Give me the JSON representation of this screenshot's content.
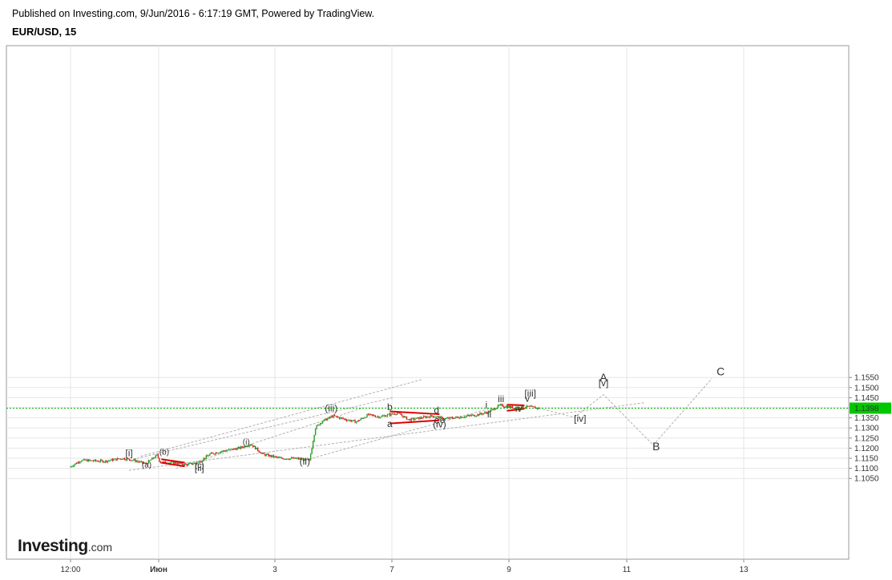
{
  "header": {
    "published": "Published on Investing.com, 9/Jun/2016 - 6:17:19 GMT, Powered by TradingView.",
    "symbol": "EUR/USD, 15"
  },
  "logo": {
    "brand": "Investing",
    "suffix": ".com"
  },
  "colors": {
    "up": "#2ca02c",
    "down": "#d62728",
    "guide": "#b0b0b0",
    "triangle": "#e00000",
    "price_line": "#00b000",
    "price_badge": "#00c800",
    "grid": "#e6e6e6"
  },
  "chart_data": {
    "type": "candlestick",
    "title": "EUR/USD, 15",
    "current_price": "1.1398",
    "ylim": [
      1.105,
      1.155
    ],
    "y_ticks": [
      "1.1550",
      "1.1500",
      "1.1450",
      "1.1400",
      "1.1350",
      "1.1300",
      "1.1250",
      "1.1200",
      "1.1150",
      "1.1100",
      "1.1050"
    ],
    "x_ticks": [
      "12:00",
      "Июн",
      "3",
      "7",
      "9",
      "11",
      "13"
    ],
    "grid": true,
    "price_path": [
      [
        0.0,
        1.1105
      ],
      [
        0.2,
        1.114
      ],
      [
        0.6,
        1.1135
      ],
      [
        0.9,
        1.115
      ],
      [
        1.1,
        1.114
      ],
      [
        1.3,
        1.1122
      ],
      [
        1.5,
        1.1165
      ],
      [
        1.55,
        1.113
      ],
      [
        1.8,
        1.1128
      ],
      [
        2.0,
        1.1118
      ],
      [
        2.2,
        1.1128
      ],
      [
        2.4,
        1.117
      ],
      [
        2.6,
        1.1185
      ],
      [
        2.9,
        1.12
      ],
      [
        3.1,
        1.122
      ],
      [
        3.3,
        1.117
      ],
      [
        3.6,
        1.115
      ],
      [
        3.9,
        1.1148
      ],
      [
        4.1,
        1.1138
      ],
      [
        4.2,
        1.13
      ],
      [
        4.3,
        1.133
      ],
      [
        4.5,
        1.136
      ],
      [
        4.7,
        1.1343
      ],
      [
        4.9,
        1.133
      ],
      [
        5.1,
        1.1365
      ],
      [
        5.3,
        1.1355
      ],
      [
        5.6,
        1.1375
      ],
      [
        5.8,
        1.134
      ],
      [
        6.0,
        1.135
      ],
      [
        6.2,
        1.136
      ],
      [
        6.4,
        1.1345
      ],
      [
        6.7,
        1.1355
      ],
      [
        6.95,
        1.1365
      ],
      [
        7.15,
        1.1378
      ],
      [
        7.35,
        1.1412
      ],
      [
        7.6,
        1.14
      ],
      [
        7.85,
        1.1405
      ],
      [
        8.0,
        1.1398
      ]
    ],
    "wave_labels": [
      {
        "text": "[i]",
        "x": 1.0,
        "y": 1.1159
      },
      {
        "text": "(b)",
        "x": 1.6,
        "y": 1.1168
      },
      {
        "text": "(a)",
        "x": 1.3,
        "y": 1.1105
      },
      {
        "text": "(c)",
        "x": 2.2,
        "y": 1.1102
      },
      {
        "text": "[ii]",
        "x": 2.2,
        "y": 1.1087
      },
      {
        "text": "(i)",
        "x": 3.0,
        "y": 1.1218
      },
      {
        "text": "(ii)",
        "x": 4.0,
        "y": 1.1118
      },
      {
        "text": "(iii)",
        "x": 4.45,
        "y": 1.1382
      },
      {
        "text": "b",
        "x": 5.45,
        "y": 1.1388
      },
      {
        "text": "a",
        "x": 5.45,
        "y": 1.1305
      },
      {
        "text": "d",
        "x": 6.25,
        "y": 1.1373
      },
      {
        "text": "c",
        "x": 6.25,
        "y": 1.1323
      },
      {
        "text": "e",
        "x": 6.35,
        "y": 1.1325
      },
      {
        "text": "(iv)",
        "x": 6.3,
        "y": 1.1302
      },
      {
        "text": "i",
        "x": 7.1,
        "y": 1.1398
      },
      {
        "text": "ii",
        "x": 7.15,
        "y": 1.1352
      },
      {
        "text": "iii",
        "x": 7.35,
        "y": 1.1428
      },
      {
        "text": "iv",
        "x": 7.65,
        "y": 1.138
      },
      {
        "text": "v",
        "x": 7.8,
        "y": 1.143
      },
      {
        "text": "[iii]",
        "x": 7.85,
        "y": 1.1455
      },
      {
        "text": "[iv]",
        "x": 8.7,
        "y": 1.133
      },
      {
        "text": "[v]",
        "x": 9.1,
        "y": 1.1507
      },
      {
        "text": "A",
        "x": 9.1,
        "y": 1.153
      },
      {
        "text": "B",
        "x": 10.0,
        "y": 1.119
      },
      {
        "text": "C",
        "x": 11.1,
        "y": 1.156
      }
    ],
    "projection": [
      [
        8.0,
        1.1398
      ],
      [
        8.6,
        1.1352
      ],
      [
        9.1,
        1.1465
      ],
      [
        9.95,
        1.1215
      ],
      [
        10.95,
        1.1545
      ]
    ],
    "channels": [
      [
        [
          1.0,
          1.114
        ],
        [
          5.5,
          1.145
        ]
      ],
      [
        [
          1.0,
          1.109
        ],
        [
          9.8,
          1.1425
        ]
      ],
      [
        [
          1.8,
          1.11
        ],
        [
          5.0,
          1.14
        ]
      ],
      [
        [
          4.0,
          1.114
        ],
        [
          7.2,
          1.14
        ]
      ],
      [
        [
          1.2,
          1.116
        ],
        [
          6.0,
          1.154
        ]
      ]
    ],
    "triangles": [
      [
        [
          [
            1.55,
            1.1145
          ],
          [
            1.95,
            1.1128
          ]
        ],
        [
          [
            1.55,
            1.1128
          ],
          [
            1.95,
            1.111
          ]
        ]
      ],
      [
        [
          [
            5.45,
            1.1382
          ],
          [
            6.3,
            1.1368
          ]
        ],
        [
          [
            5.45,
            1.1322
          ],
          [
            6.3,
            1.1338
          ]
        ]
      ],
      [
        [
          [
            7.45,
            1.1415
          ],
          [
            7.75,
            1.1412
          ]
        ],
        [
          [
            7.45,
            1.1385
          ],
          [
            7.75,
            1.1395
          ]
        ]
      ]
    ]
  }
}
